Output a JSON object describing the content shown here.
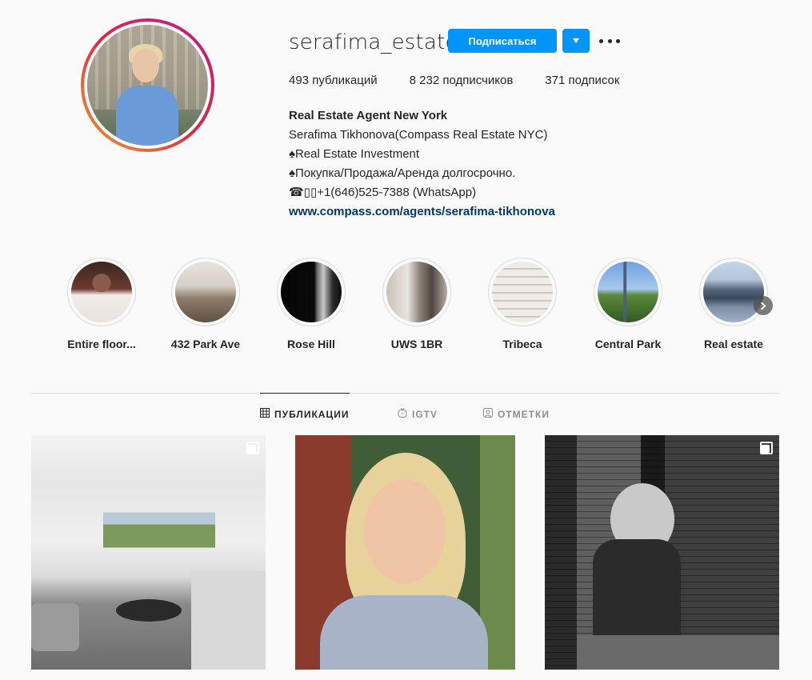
{
  "profile": {
    "username": "serafima_estate",
    "follow_label": "Подписаться",
    "stats": {
      "posts": "493 публикаций",
      "followers": "8 232 подписчиков",
      "following": "371 подписок"
    },
    "bio": {
      "name": "Real Estate Agent New York",
      "lines": [
        "Serafima Tikhonova(Compass Real Estate NYC)",
        "♠Real Estate Investment",
        "♠Покупка/Продажа/Аренда долгосрочно.",
        "☎▯▯+1(646)525-7388 (WhatsApp)"
      ],
      "link": "www.compass.com/agents/serafima-tikhonova"
    }
  },
  "highlights": [
    {
      "label": "Entire floor..."
    },
    {
      "label": "432 Park Ave"
    },
    {
      "label": "Rose Hill"
    },
    {
      "label": "UWS 1BR"
    },
    {
      "label": "Tribeca"
    },
    {
      "label": "Central Park"
    },
    {
      "label": "Real estate"
    }
  ],
  "tabs": [
    {
      "label": "ПУБЛИКАЦИИ",
      "icon": "grid-icon",
      "active": true
    },
    {
      "label": "IGTV",
      "icon": "igtv-icon",
      "active": false
    },
    {
      "label": "ОТМЕТКИ",
      "icon": "tagged-icon",
      "active": false
    }
  ],
  "posts": [
    {
      "description_icon": "multi-image-icon",
      "multi": true
    },
    {
      "multi": false
    },
    {
      "description_icon": "multi-image-icon",
      "multi": true
    }
  ],
  "colors": {
    "accent": "#0095f6",
    "link": "#00376b",
    "text": "#262626",
    "muted": "#8e8e8e",
    "border": "#dbdbdb"
  }
}
